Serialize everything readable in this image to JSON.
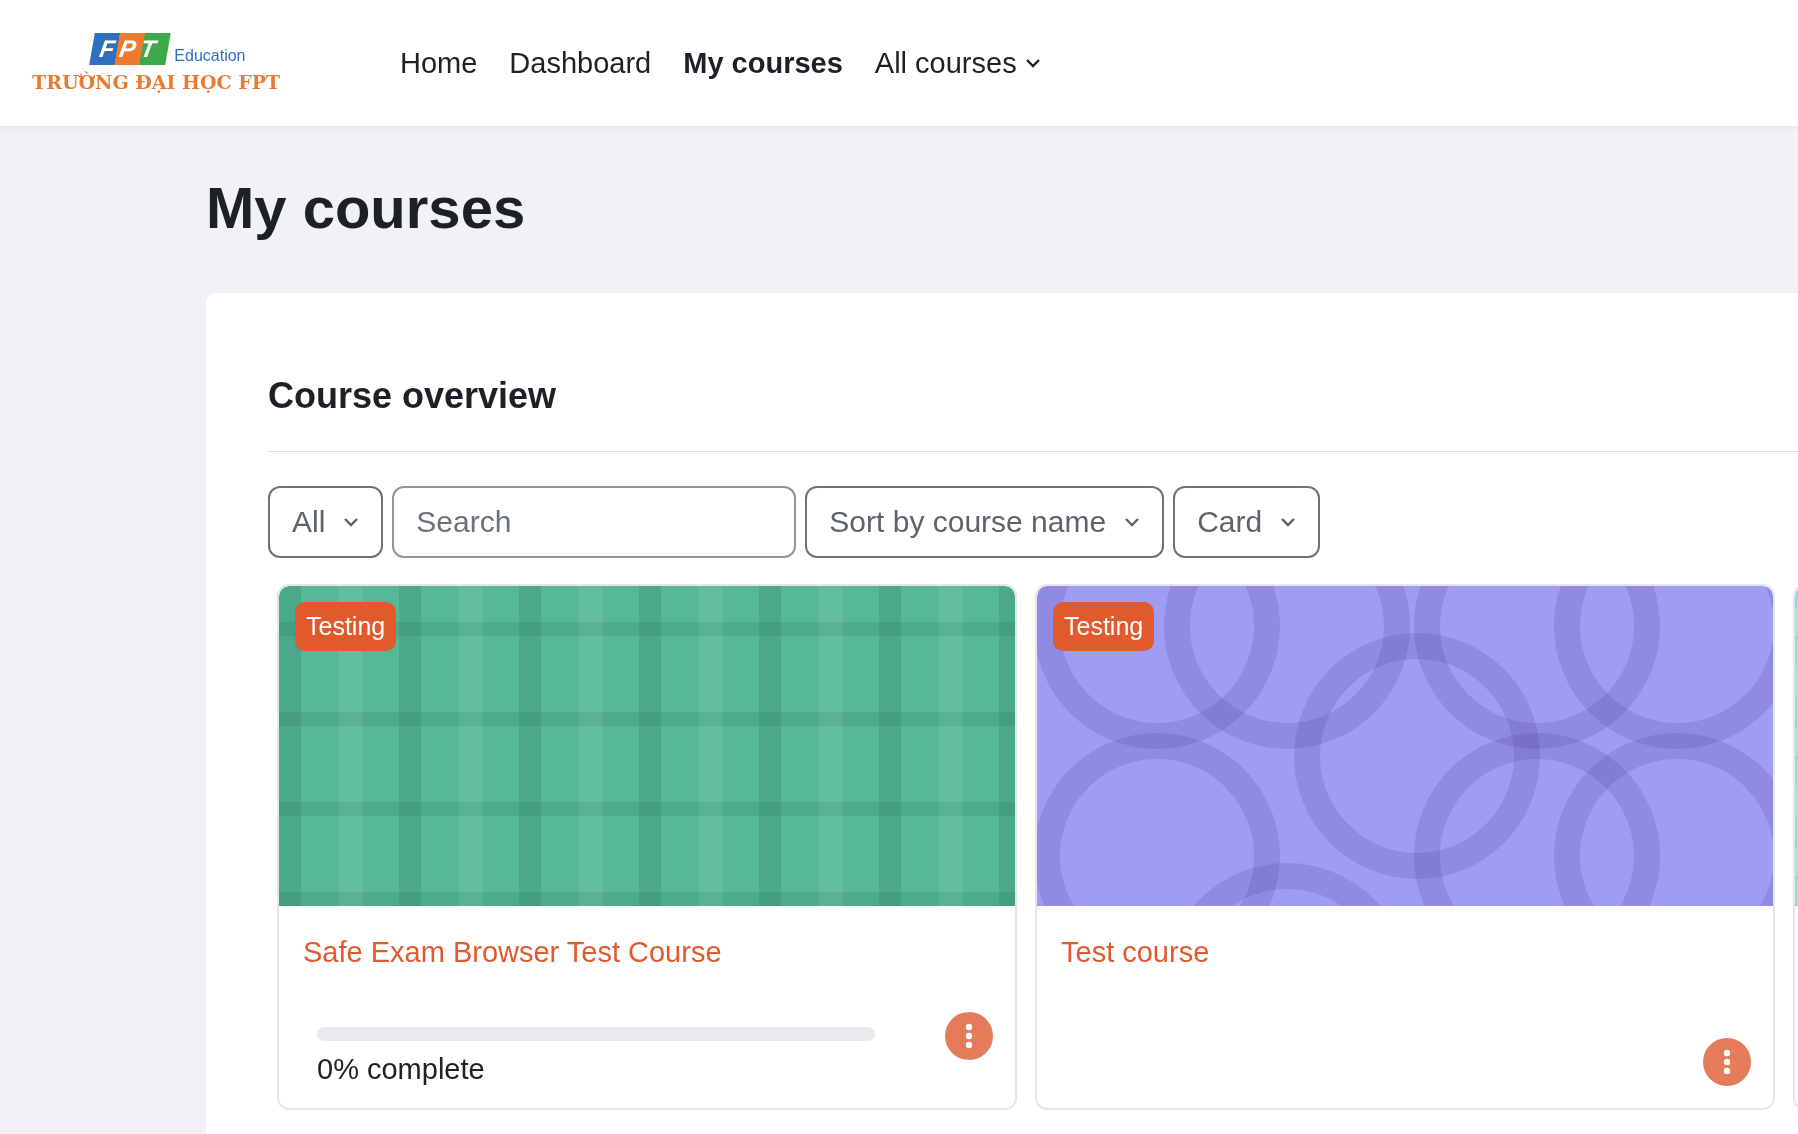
{
  "header": {
    "logo": {
      "wordmark": "FPT",
      "tagline": "Education",
      "name": "TRƯỜNG ĐẠI HỌC FPT"
    },
    "nav": [
      {
        "label": "Home",
        "selected": false,
        "dropdown": false
      },
      {
        "label": "Dashboard",
        "selected": false,
        "dropdown": false
      },
      {
        "label": "My courses",
        "selected": true,
        "dropdown": false
      },
      {
        "label": "All courses",
        "selected": false,
        "dropdown": true
      }
    ]
  },
  "page_title": "My courses",
  "course_overview": {
    "title": "Course overview",
    "filters": [
      {
        "kind": "dropdown",
        "label": "All"
      },
      {
        "kind": "search",
        "placeholder": "Search"
      },
      {
        "kind": "dropdown",
        "label": "Sort by course name"
      },
      {
        "kind": "dropdown",
        "label": "Card"
      }
    ],
    "courses": [
      {
        "kind": "plaid",
        "category": "Testing",
        "name": "Safe Exam Browser Test Course",
        "progress": {
          "level": 0,
          "text": "0% complete"
        }
      },
      {
        "kind": "circles",
        "category": "Testing",
        "name": "Test course"
      },
      {
        "kind": "stripes"
      }
    ]
  }
}
